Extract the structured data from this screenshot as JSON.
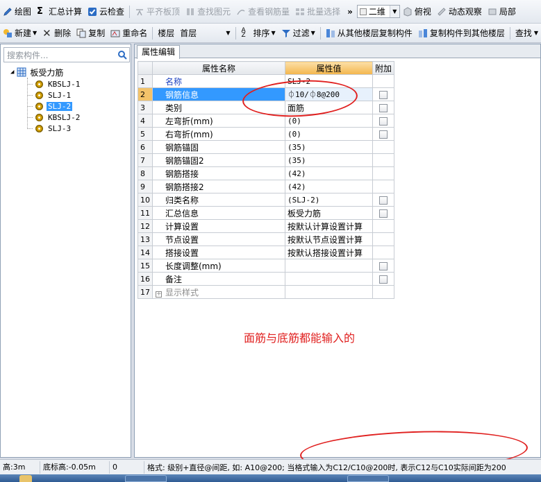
{
  "toolbar1": {
    "items": [
      {
        "label": "绘图",
        "icon": "pencil-icon",
        "enabled": true
      },
      {
        "label": "汇总计算",
        "icon": "sigma-icon",
        "enabled": true
      },
      {
        "label": "云检查",
        "icon": "cloud-check-icon",
        "enabled": true
      },
      {
        "label": "平齐板顶",
        "icon": "align-top-icon",
        "enabled": false
      },
      {
        "label": "查找图元",
        "icon": "find-icon",
        "enabled": false
      },
      {
        "label": "查看钢筋量",
        "icon": "rebar-icon",
        "enabled": false
      },
      {
        "label": "批量选择",
        "icon": "batch-select-icon",
        "enabled": false
      }
    ],
    "view_mode": "二维",
    "view_items": [
      {
        "label": "俯视",
        "icon": "top-view-icon"
      },
      {
        "label": "动态观察",
        "icon": "orbit-icon"
      },
      {
        "label": "局部",
        "icon": "local-view-icon"
      }
    ]
  },
  "toolbar2": {
    "new_label": "新建",
    "delete_label": "删除",
    "copy_label": "复制",
    "rename_label": "重命名",
    "floor_label": "楼层",
    "floor_value": "首层",
    "sort_label": "排序",
    "filter_label": "过滤",
    "copy_from_floor_label": "从其他楼层复制构件",
    "copy_to_floor_label": "复制构件到其他楼层",
    "find_label": "查找"
  },
  "left_panel": {
    "search_placeholder": "搜索构件...",
    "root_label": "板受力筋",
    "items": [
      "KBSLJ-1",
      "SLJ-1",
      "SLJ-2",
      "KBSLJ-2",
      "SLJ-3"
    ],
    "selected_index": 2
  },
  "right_panel": {
    "tab_label": "属性编辑",
    "columns": [
      "属性名称",
      "属性值",
      "附加"
    ],
    "rows": [
      {
        "num": "1",
        "name": "名称",
        "value": "SLJ-2",
        "checkbox": false,
        "blue": true
      },
      {
        "num": "2",
        "name": "钢筋信息",
        "value": "⏀10/⏀8@200",
        "checkbox": true,
        "selected": true
      },
      {
        "num": "3",
        "name": "类别",
        "value": "面筋",
        "checkbox": true
      },
      {
        "num": "4",
        "name": "左弯折(mm)",
        "value": "(0)",
        "checkbox": true
      },
      {
        "num": "5",
        "name": "右弯折(mm)",
        "value": "(0)",
        "checkbox": true
      },
      {
        "num": "6",
        "name": "钢筋锚固",
        "value": "(35)",
        "checkbox": false
      },
      {
        "num": "7",
        "name": "钢筋锚固2",
        "value": "(35)",
        "checkbox": false
      },
      {
        "num": "8",
        "name": "钢筋搭接",
        "value": "(42)",
        "checkbox": false
      },
      {
        "num": "9",
        "name": "钢筋搭接2",
        "value": "(42)",
        "checkbox": false
      },
      {
        "num": "10",
        "name": "归类名称",
        "value": "(SLJ-2)",
        "checkbox": true
      },
      {
        "num": "11",
        "name": "汇总信息",
        "value": "板受力筋",
        "checkbox": true
      },
      {
        "num": "12",
        "name": "计算设置",
        "value": "按默认计算设置计算",
        "checkbox": false
      },
      {
        "num": "13",
        "name": "节点设置",
        "value": "按默认节点设置计算",
        "checkbox": false
      },
      {
        "num": "14",
        "name": "搭接设置",
        "value": "按默认搭接设置计算",
        "checkbox": false
      },
      {
        "num": "15",
        "name": "长度调整(mm)",
        "value": "",
        "checkbox": true
      },
      {
        "num": "16",
        "name": "备注",
        "value": "",
        "checkbox": true
      },
      {
        "num": "17",
        "name": "显示样式",
        "value": "",
        "checkbox": false,
        "expand": true
      }
    ],
    "annotation": "面筋与底筋都能输入的"
  },
  "status_bar": {
    "height": "高:3m",
    "bottom_elevation": "底标高:-0.05m",
    "zero": "0",
    "hint": "格式: 级别+直径@间距, 如: A10@200; 当格式输入为C12/C10@200时, 表示C12与C10实际间距为200"
  },
  "colors": {
    "annotation_red": "#e0201f",
    "selection_blue": "#3399ff",
    "header_orange": "#f3b64c"
  }
}
